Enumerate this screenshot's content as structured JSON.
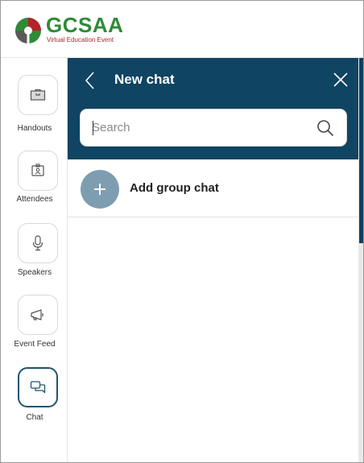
{
  "header": {
    "brand_name": "GCSAA",
    "brand_subtitle": "Virtual Education Event"
  },
  "rail": {
    "items": [
      {
        "label": "Handouts",
        "icon": "briefcase-icon",
        "active": false
      },
      {
        "label": "Attendees",
        "icon": "badge-icon",
        "active": false
      },
      {
        "label": "Speakers",
        "icon": "microphone-icon",
        "active": false
      },
      {
        "label": "Event Feed",
        "icon": "megaphone-icon",
        "active": false
      },
      {
        "label": "Chat",
        "icon": "chat-icon",
        "active": true
      }
    ]
  },
  "chat_panel": {
    "title": "New chat",
    "search_placeholder": "Search",
    "search_value": "",
    "add_group_label": "Add group chat"
  },
  "colors": {
    "brand_green": "#2e8b36",
    "brand_red": "#b2232a",
    "panel_header": "#0f4462",
    "avatar_bg": "#7f9db1"
  }
}
